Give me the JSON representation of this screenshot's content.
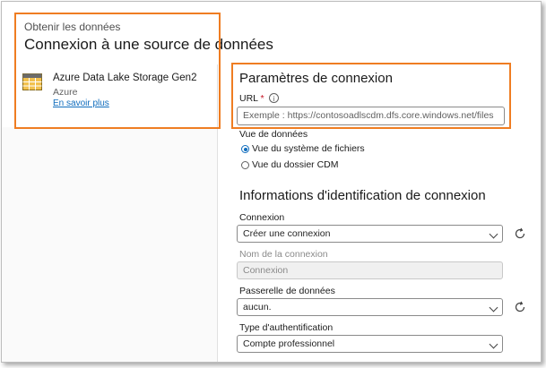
{
  "header": {
    "breadcrumb": "Obtenir les données",
    "title": "Connexion à une source de données"
  },
  "connector": {
    "icon": "table-grid-icon",
    "name": "Azure Data Lake Storage Gen2",
    "category": "Azure",
    "learn_more": "En savoir plus"
  },
  "connection_params": {
    "title": "Paramètres de connexion",
    "url_label": "URL",
    "url_required_mark": "*",
    "url_info_glyph": "i",
    "url_placeholder": "Exemple : https://contosoadlscdm.dfs.core.windows.net/files",
    "view_label": "Vue de données",
    "view_options": [
      {
        "label": "Vue du système de fichiers",
        "selected": true
      },
      {
        "label": "Vue du dossier CDM",
        "selected": false
      }
    ]
  },
  "credentials": {
    "title": "Informations d'identification de connexion",
    "connection_label": "Connexion",
    "connection_value": "Créer une connexion",
    "connection_name_label": "Nom de la connexion",
    "connection_name_value": "Connexion",
    "gateway_label": "Passerelle de données",
    "gateway_value": "aucun.",
    "auth_label": "Type d'authentification",
    "auth_value": "Compte professionnel"
  },
  "colors": {
    "highlight": "#ef7d22",
    "accent": "#0f6cbd",
    "required": "#c50f1f"
  }
}
